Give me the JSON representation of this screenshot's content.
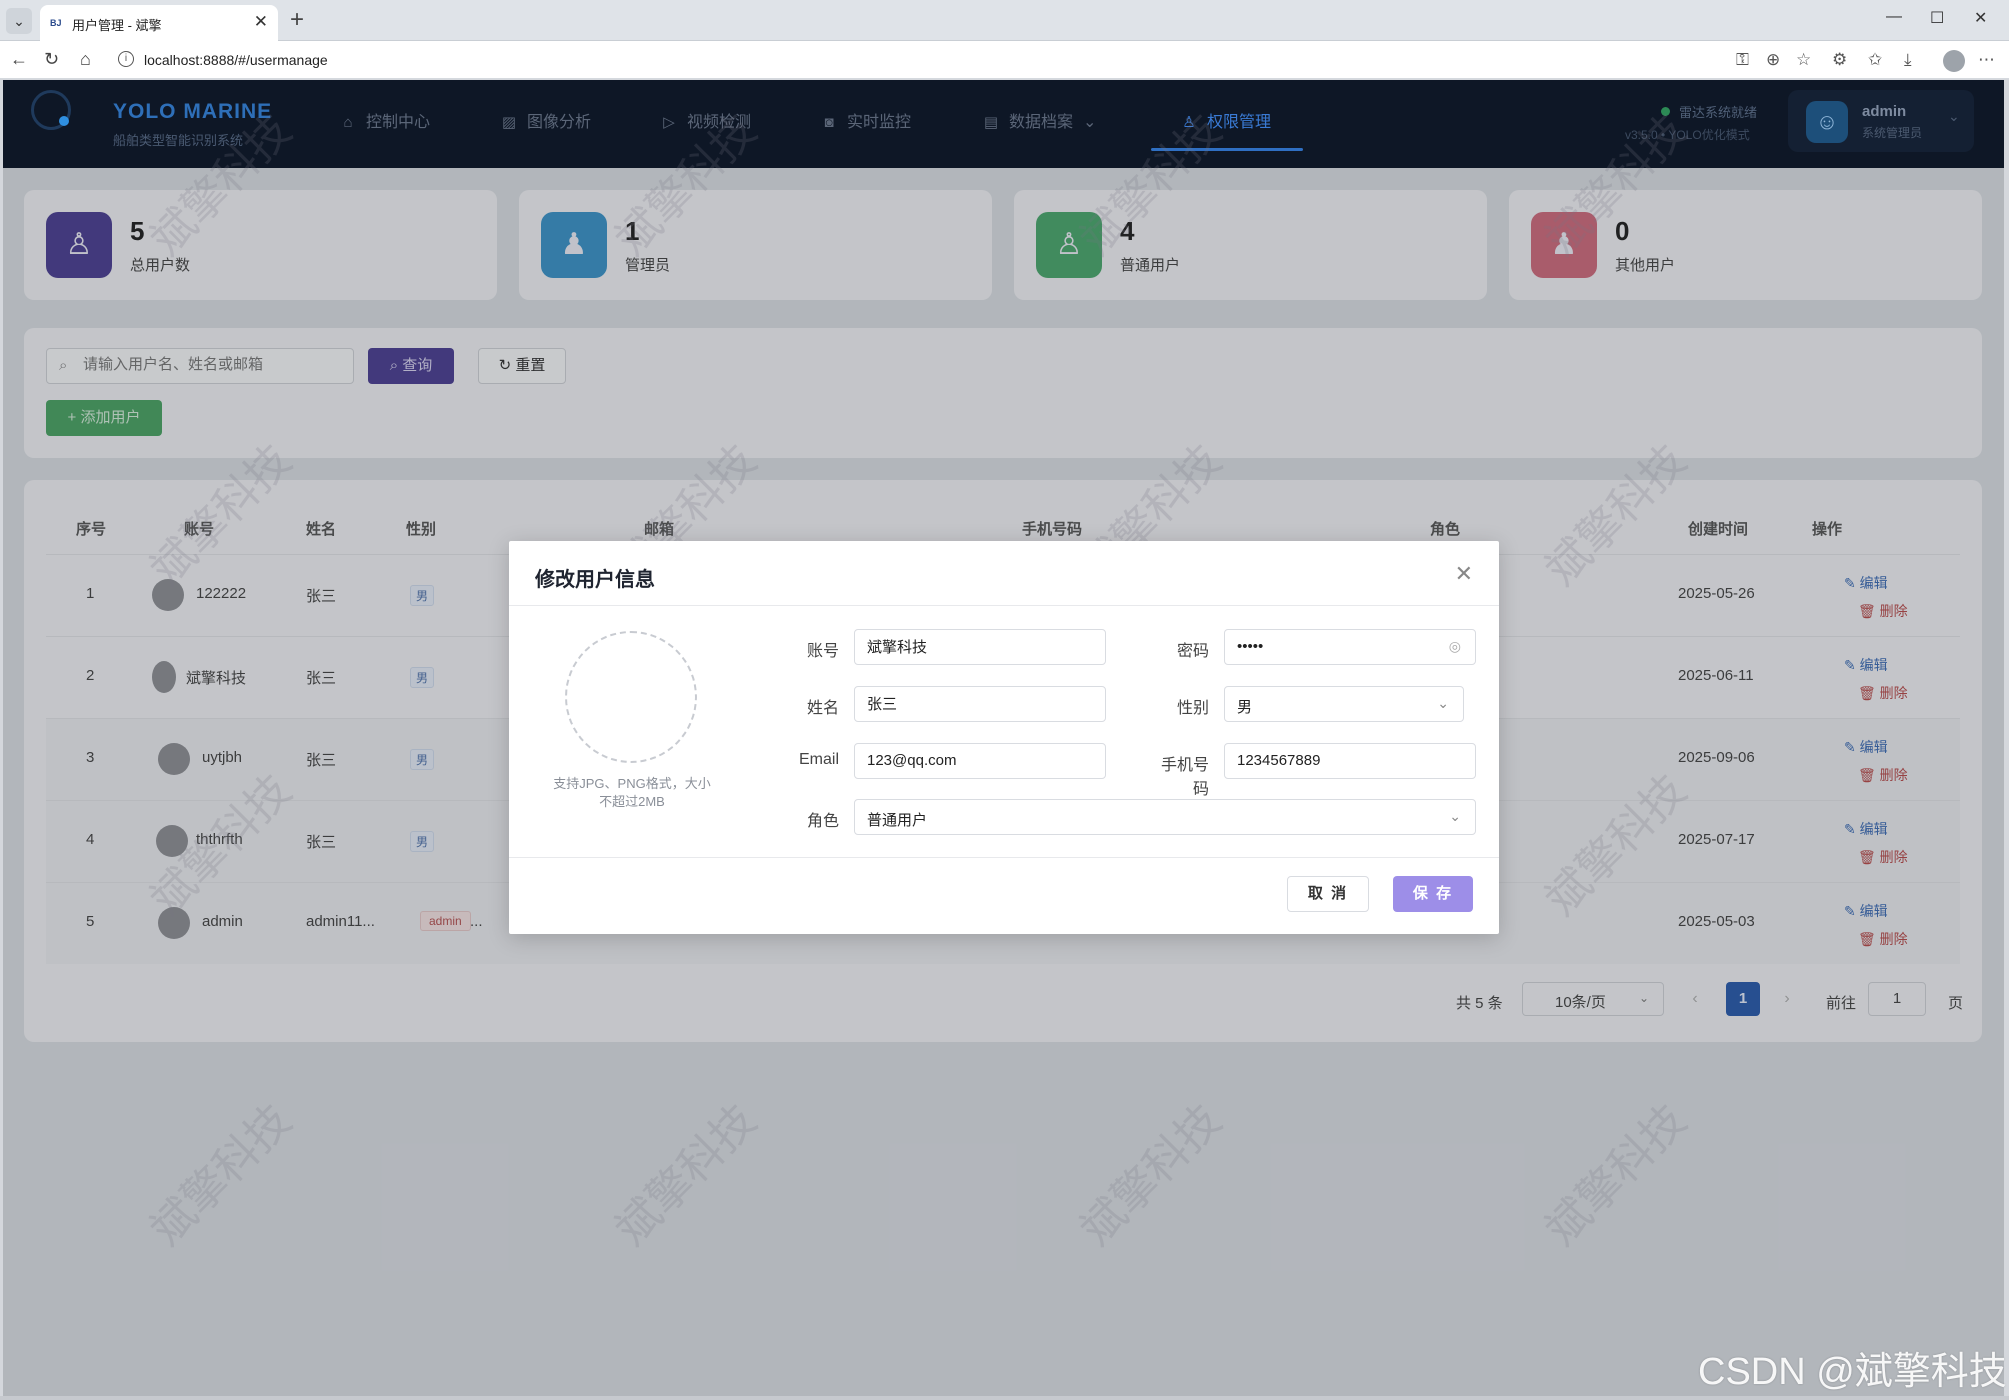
{
  "browser": {
    "tab_title": "用户管理 - 斌擎",
    "tab_favicon": "BJ",
    "url": "localhost:8888/#/usermanage"
  },
  "header": {
    "brand_title": "YOLO MARINE",
    "brand_subtitle": "船舶类型智能识别系统",
    "nav": [
      {
        "label": "控制中心",
        "icon": "home-icon"
      },
      {
        "label": "图像分析",
        "icon": "image-icon"
      },
      {
        "label": "视频检测",
        "icon": "play-icon"
      },
      {
        "label": "实时监控",
        "icon": "camera-icon"
      },
      {
        "label": "数据档案",
        "icon": "document-icon"
      },
      {
        "label": "权限管理",
        "icon": "user-icon",
        "active": true
      }
    ],
    "status": "雷达系统就绪",
    "version": "v3.5.0 • YOLO优化模式",
    "user": {
      "name": "admin",
      "role": "系统管理员"
    }
  },
  "stats": [
    {
      "value": "5",
      "label": "总用户数",
      "color": "#4b3f8f"
    },
    {
      "value": "1",
      "label": "管理员",
      "color": "#3b8fc2"
    },
    {
      "value": "4",
      "label": "普通用户",
      "color": "#4aa36b"
    },
    {
      "value": "0",
      "label": "其他用户",
      "color": "#c9697a"
    }
  ],
  "search": {
    "placeholder": "请输入用户名、姓名或邮箱",
    "query_label": "查询",
    "reset_label": "重置",
    "add_label": "添加用户"
  },
  "table": {
    "headers": [
      "序号",
      "账号",
      "姓名",
      "性别",
      "邮箱",
      "手机号码",
      "角色",
      "创建时间",
      "操作"
    ],
    "rows": [
      {
        "index": "1",
        "account": "122222",
        "name": "张三",
        "gender": "男",
        "created": "2025-05-26"
      },
      {
        "index": "2",
        "account": "斌擎科技",
        "name": "张三",
        "gender": "男",
        "created": "2025-06-11"
      },
      {
        "index": "3",
        "account": "uytjbh",
        "name": "张三",
        "gender": "男",
        "created": "2025-09-06"
      },
      {
        "index": "4",
        "account": "ththrfth",
        "name": "张三",
        "gender": "男",
        "created": "2025-07-17"
      },
      {
        "index": "5",
        "account": "admin",
        "name": "admin11...",
        "role_tag": "admin",
        "role_more": "...",
        "created": "2025-05-03"
      }
    ],
    "edit_label": "编辑",
    "delete_label": "删除"
  },
  "pagination": {
    "total": "共 5 条",
    "page_size": "10条/页",
    "current": "1",
    "goto_label": "前往",
    "goto_value": "1",
    "page_unit": "页"
  },
  "modal": {
    "title": "修改用户信息",
    "avatar_hint": "支持JPG、PNG格式，大小不超过2MB",
    "fields": {
      "account": {
        "label": "账号",
        "value": "斌擎科技"
      },
      "password": {
        "label": "密码",
        "value": "•••••"
      },
      "name": {
        "label": "姓名",
        "value": "张三"
      },
      "gender": {
        "label": "性别",
        "value": "男"
      },
      "email": {
        "label": "Email",
        "value": "123@qq.com"
      },
      "phone": {
        "label": "手机号码",
        "value": "1234567889"
      },
      "role": {
        "label": "角色",
        "value": "普通用户"
      }
    },
    "cancel_label": "取 消",
    "save_label": "保 存"
  },
  "watermark": "斌擎科技",
  "csdn_watermark": "CSDN @斌擎科技"
}
